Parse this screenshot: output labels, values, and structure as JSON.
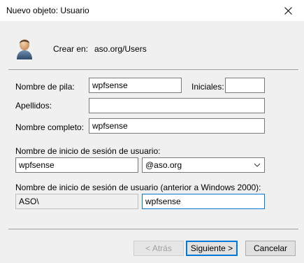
{
  "window": {
    "title": "Nuevo objeto: Usuario"
  },
  "icons": {
    "close": "close-icon",
    "user": "user-icon",
    "dropdown": "chevron-down-icon"
  },
  "header": {
    "create_in_label": "Crear en:",
    "create_in_value": "aso.org/Users"
  },
  "form": {
    "first_name_label": "Nombre de pila:",
    "first_name_value": "wpfsense",
    "initials_label": "Iniciales:",
    "initials_value": "",
    "last_name_label": "Apellidos:",
    "last_name_value": "",
    "full_name_label": "Nombre completo:",
    "full_name_value": "wpfsense",
    "logon_name_label": "Nombre de inicio de sesión de usuario:",
    "logon_name_value": "wpfsense",
    "domain_value": "@aso.org",
    "pre2000_label": "Nombre de inicio de sesión de usuario (anterior a Windows 2000):",
    "pre2000_domain_value": "ASO\\",
    "pre2000_name_value": "wpfsense"
  },
  "footer": {
    "back_label": "< Atrás",
    "next_label": "Siguiente >",
    "cancel_label": "Cancelar"
  },
  "colors": {
    "accent": "#0078d7",
    "background": "#f0f0f0"
  }
}
